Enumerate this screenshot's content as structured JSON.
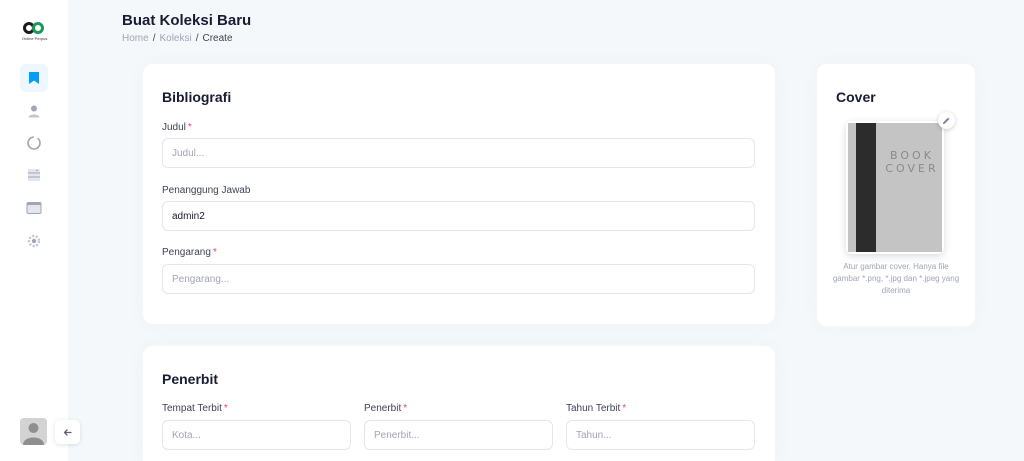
{
  "sidebar": {
    "logo_text": "Online Perpus",
    "nav": [
      {
        "name": "bookmark-icon",
        "active": true
      },
      {
        "name": "user-icon",
        "active": false
      },
      {
        "name": "loading-circle-icon",
        "active": false
      },
      {
        "name": "archive-icon",
        "active": false
      },
      {
        "name": "wallet-icon",
        "active": false
      },
      {
        "name": "gear-icon",
        "active": false
      }
    ],
    "toggle_icon": "arrow-left-icon"
  },
  "header": {
    "title": "Buat Koleksi Baru",
    "breadcrumb": [
      "Home",
      "Koleksi",
      "Create"
    ],
    "separator": "/"
  },
  "bibliografi": {
    "title": "Bibliografi",
    "judul": {
      "label": "Judul",
      "required_mark": "*",
      "placeholder": "Judul...",
      "value": ""
    },
    "penanggung_jawab": {
      "label": "Penanggung Jawab",
      "value": "admin2"
    },
    "pengarang": {
      "label": "Pengarang",
      "required_mark": "*",
      "placeholder": "Pengarang...",
      "value": ""
    }
  },
  "penerbit": {
    "title": "Penerbit",
    "tempat_terbit": {
      "label": "Tempat Terbit",
      "required_mark": "*",
      "placeholder": "Kota..."
    },
    "penerbit": {
      "label": "Penerbit",
      "required_mark": "*",
      "placeholder": "Penerbit..."
    },
    "tahun_terbit": {
      "label": "Tahun Terbit",
      "required_mark": "*",
      "placeholder": "Tahun..."
    }
  },
  "cover": {
    "title": "Cover",
    "book_text_line1": "BOOK",
    "book_text_line2": "COVER",
    "hint": "Atur gambar cover. Hanya file gambar *.png, *.jpg dan *.jpeg yang diterima"
  },
  "colors": {
    "accent": "#009ef7",
    "required": "#f1416c",
    "background": "#f5f8fa"
  }
}
